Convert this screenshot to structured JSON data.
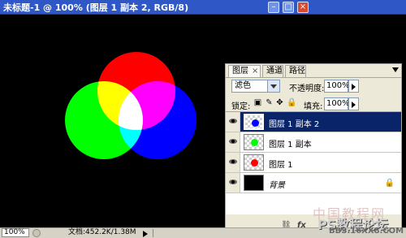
{
  "window": {
    "title": "未标题-1 @ 100% (图层 1 副本 2, RGB/8)",
    "min": "–",
    "max": "□",
    "close": "×"
  },
  "panel": {
    "tabs": [
      {
        "label": "图层",
        "close": "×"
      },
      {
        "label": "通道"
      },
      {
        "label": "路径"
      }
    ],
    "blend_mode": "滤色",
    "opacity_label": "不透明度:",
    "opacity_value": "100%",
    "lock_label": "锁定:",
    "lock_icons": [
      "transparency-lock-icon",
      "brush-lock-icon",
      "move-lock-icon",
      "padlock-icon"
    ],
    "fill_label": "填充:",
    "fill_value": "100%",
    "layers": [
      {
        "name": "图层 1 副本 2",
        "selected": true,
        "color": "#0000ff"
      },
      {
        "name": "图层 1 副本",
        "selected": false,
        "color": "#00ff00"
      },
      {
        "name": "图层 1",
        "selected": false,
        "color": "#ff0000"
      },
      {
        "name": "背景",
        "selected": false,
        "color": "#000000",
        "locked": true
      }
    ],
    "footer_icons": [
      "link-icon",
      "fx-icon"
    ]
  },
  "status": {
    "zoom": "100%",
    "doc": "文档:452.2K/1.38M"
  },
  "watermark": {
    "line1": "中国教程网",
    "line2": "PS教程论坛",
    "line3": "BBS.16XX8.COM"
  },
  "chart_data": {
    "circles": [
      {
        "color": "#ff0000"
      },
      {
        "color": "#00ff00"
      },
      {
        "color": "#0000ff"
      }
    ]
  }
}
